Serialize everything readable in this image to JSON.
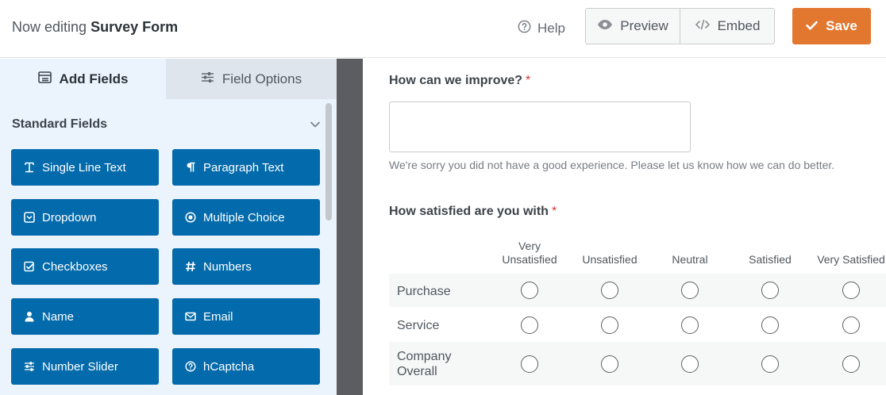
{
  "header": {
    "title_prefix": "Now editing",
    "form_name": "Survey Form",
    "help_label": "Help",
    "preview_label": "Preview",
    "embed_label": "Embed",
    "save_label": "Save",
    "save_color": "#e27730"
  },
  "sidebar": {
    "tabs": [
      {
        "label": "Add Fields",
        "icon": "list-icon",
        "active": true
      },
      {
        "label": "Field Options",
        "icon": "sliders-icon",
        "active": false
      }
    ],
    "section_title": "Standard Fields",
    "button_color": "#036aab",
    "fields": [
      {
        "label": "Single Line Text",
        "icon": "text-cursor-icon"
      },
      {
        "label": "Paragraph Text",
        "icon": "paragraph-icon"
      },
      {
        "label": "Dropdown",
        "icon": "dropdown-icon"
      },
      {
        "label": "Multiple Choice",
        "icon": "radio-icon"
      },
      {
        "label": "Checkboxes",
        "icon": "checkbox-icon"
      },
      {
        "label": "Numbers",
        "icon": "hash-icon"
      },
      {
        "label": "Name",
        "icon": "user-icon"
      },
      {
        "label": "Email",
        "icon": "envelope-icon"
      },
      {
        "label": "Number Slider",
        "icon": "sliders-icon"
      },
      {
        "label": "hCaptcha",
        "icon": "question-circle-icon"
      }
    ]
  },
  "form": {
    "q1": {
      "label": "How can we improve?",
      "required_mark": "*",
      "description": "We're sorry you did not have a good experience. Please let us know how we can do better."
    },
    "q2": {
      "label": "How satisfied are you with",
      "required_mark": "*",
      "columns": [
        {
          "line1": "Very",
          "line2": "Unsatisfied"
        },
        {
          "line1": "",
          "line2": "Unsatisfied"
        },
        {
          "line1": "",
          "line2": "Neutral"
        },
        {
          "line1": "",
          "line2": "Satisfied"
        },
        {
          "line1": "",
          "line2": "Very Satisfied"
        }
      ],
      "rows": [
        {
          "line1": "Purchase",
          "line2": ""
        },
        {
          "line1": "Service",
          "line2": ""
        },
        {
          "line1": "Company",
          "line2": "Overall"
        }
      ]
    }
  }
}
